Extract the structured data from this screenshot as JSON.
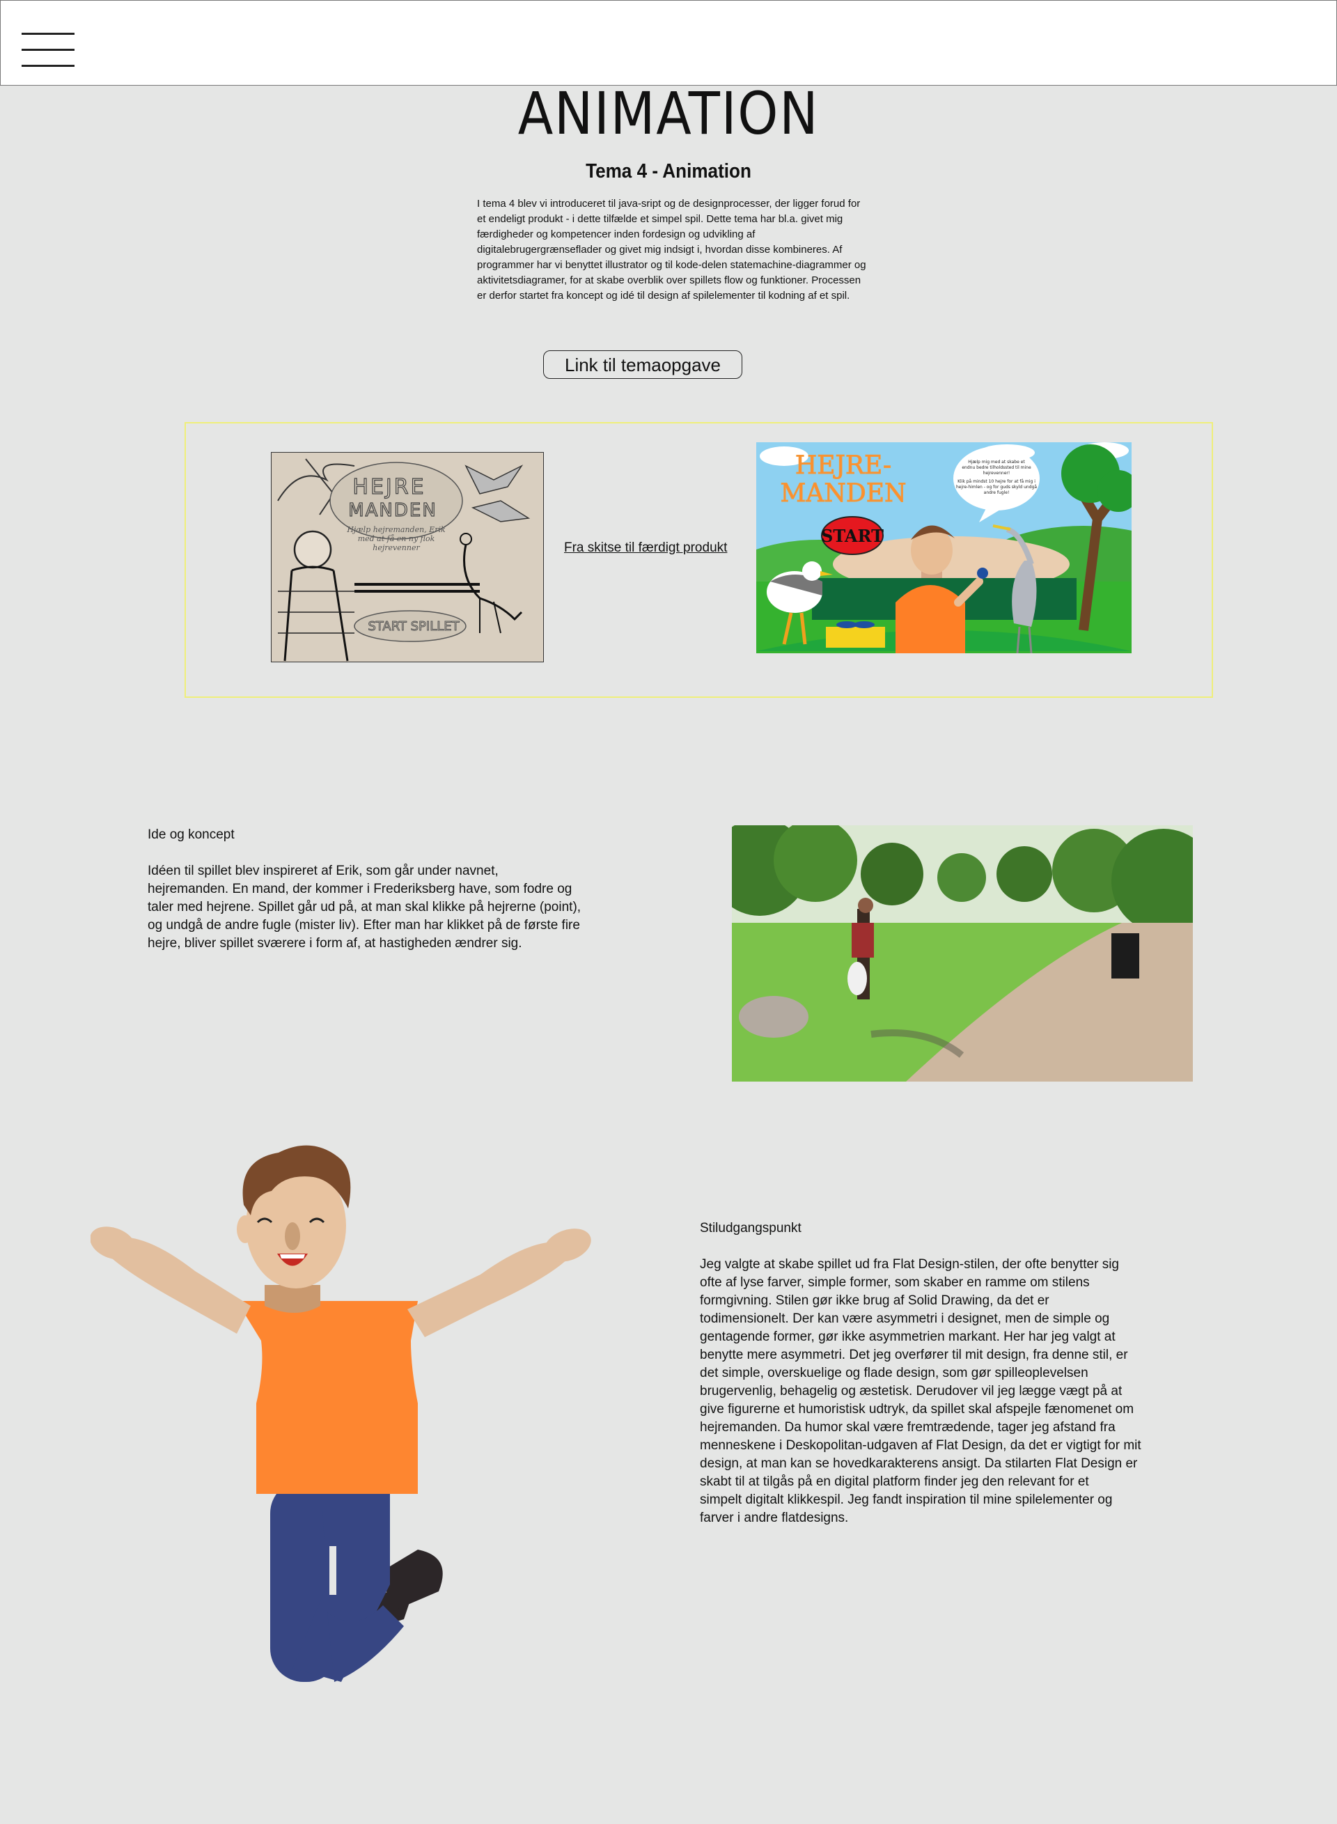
{
  "nav": {
    "menu_icon": "hamburger-menu-icon"
  },
  "header": {
    "title": "ANIMATION",
    "subtitle": "Tema 4 - Animation",
    "intro": "I tema 4 blev vi introduceret til java-sript og de designprocesser, der ligger forud for et endeligt produkt - i dette tilfælde et simpel spil. Dette tema har bl.a. givet mig færdigheder og kompetencer inden fordesign og udvikling af digitalebrugergrænseflader og givet mig indsigt i, hvordan disse kombineres. Af programmer har vi benyttet illustrator og til kode-delen statemachine-diagrammer og aktivitetsdiagramer, for at skabe overblik over spillets flow og funktioner. Processen er derfor startet fra koncept og idé til design af spilelementer til kodning af et spil.",
    "link_button": "Link til temaopgave"
  },
  "showcase": {
    "sketch_link": "Fra skitse til færdigt produkt",
    "sketch": {
      "title_line1": "HEJRE",
      "title_line2": "MANDEN",
      "caption_line1": "Hjælp hejremanden, Erik",
      "caption_line2": "med at få en ny flok",
      "caption_line3": "hejrevenner",
      "start": "START SPILLET"
    },
    "final": {
      "title_line1": "HEJRE-",
      "title_line2": "MANDEN",
      "start": "START",
      "bubble_line1": "Hjælp mig med at skabe et",
      "bubble_line2": "endnu bedre tilholdssted til mine",
      "bubble_line3": "hejrevenner!",
      "bubble_line4": "Klik på mindst 10 hejre for at få mig i",
      "bubble_line5": "hejre-himlen - og for guds skyld undgå",
      "bubble_line6": "andre fugle!"
    }
  },
  "idea": {
    "heading": "Ide og koncept",
    "lines": [
      "Idéen til spillet blev inspireret af Erik, som går under navnet,",
      "hejremanden. En mand, der kommer i Frederiksberg have, som fodre og",
      "taler med hejrene. Spillet går ud på, at man skal klikke på hejrerne (point),",
      "og undgå de andre fugle (mister liv). Efter man har klikket på de første fire",
      "hejre, bliver spillet sværere i form af, at hastigheden ændrer sig."
    ]
  },
  "style": {
    "heading": "Stiludgangspunkt",
    "lines": [
      "Jeg valgte at skabe spillet ud fra Flat Design-stilen, der ofte benytter sig",
      "ofte af lyse farver, simple former, som skaber en ramme om stilens",
      "formgivning. Stilen gør ikke brug af Solid Drawing, da det er",
      "todimensionelt. Der kan være asymmetri i designet, men de simple og",
      "gentagende former, gør ikke asymmetrien markant. Her har jeg valgt at",
      "benytte mere asymmetri. Det jeg overfører til mit design, fra denne stil, er",
      "det simple, overskuelige og flade design, som gør spilleoplevelsen",
      "brugervenlig, behagelig og æstetisk. Derudover vil jeg lægge vægt på at",
      "give figurerne et humoristisk udtryk, da spillet skal afspejle fænomenet om",
      "hejremanden. Da humor skal være fremtrædende, tager jeg afstand fra",
      "menneskene i Deskopolitan-udgaven af Flat Design, da det er vigtigt for mit",
      "design, at man kan se hovedkarakterens ansigt. Da stilarten Flat Design er",
      "skabt til at tilgås på en digital platform finder jeg den relevant for et",
      "simpelt digitalt klikkespil. Jeg fandt inspiration til mine spilelementer og",
      "farver i andre flatdesigns."
    ]
  },
  "colors": {
    "background": "#e5e6e5",
    "frame_border": "#efef7a",
    "shirt": "#fe8630",
    "pants": "#374683",
    "skin": "#e0bb96",
    "hair": "#7a4a2b"
  }
}
